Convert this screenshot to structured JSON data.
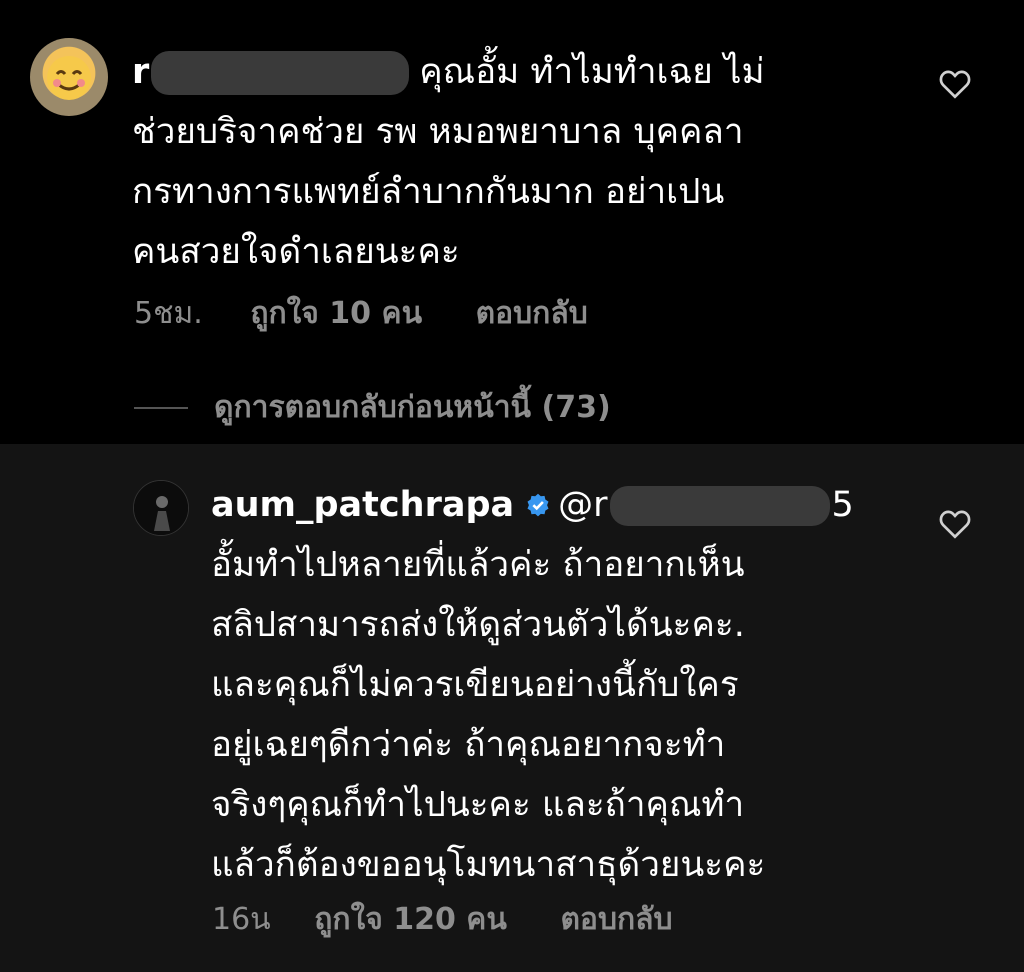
{
  "comment1": {
    "username_visible_start": "r",
    "text_line1": "คุณอั้ม ทำไมทำเฉย ไม่",
    "text_line2": "ช่วยบริจาคช่วย รพ หมอพยาบาล บุคคลา",
    "text_line3": "กรทางการแพทย์ลำบากกันมาก  อย่าเปน",
    "text_line4": "คนสวยใจดำเลยนะคะ",
    "time": "5ชม.",
    "likes": "ถูกใจ 10 คน",
    "reply": "ตอบกลับ"
  },
  "view_replies": "ดูการตอบกลับก่อนหน้านี้ (73)",
  "comment2": {
    "username": "aum_patchrapa",
    "mention_start": "@r",
    "mention_end": "5",
    "text_line1": "อั้มทำไปหลายที่แล้วค่ะ ถ้าอยากเห็น",
    "text_line2": "สลิปสามารถส่งให้ดูส่วนตัวได้นะคะ.",
    "text_line3": "และคุณก็ไม่ควรเขียนอย่างนี้กับใคร",
    "text_line4": "อยู่เฉยๆดีกว่าค่ะ ถ้าคุณอยากจะทำ",
    "text_line5": "จริงๆคุณก็ทำไปนะคะ และถ้าคุณทำ",
    "text_line6": "แล้วก็ต้องขออนุโมทนาสาธุด้วยนะคะ",
    "time": "16น",
    "likes": "ถูกใจ 120 คน",
    "reply": "ตอบกลับ"
  },
  "colors": {
    "background_top": "#000000",
    "background_bottom": "#141414",
    "text_primary": "#ffffff",
    "text_secondary": "#8e8e8e",
    "verified": "#3897f0"
  },
  "icons": [
    "heart-outline-icon",
    "verified-badge-icon"
  ]
}
